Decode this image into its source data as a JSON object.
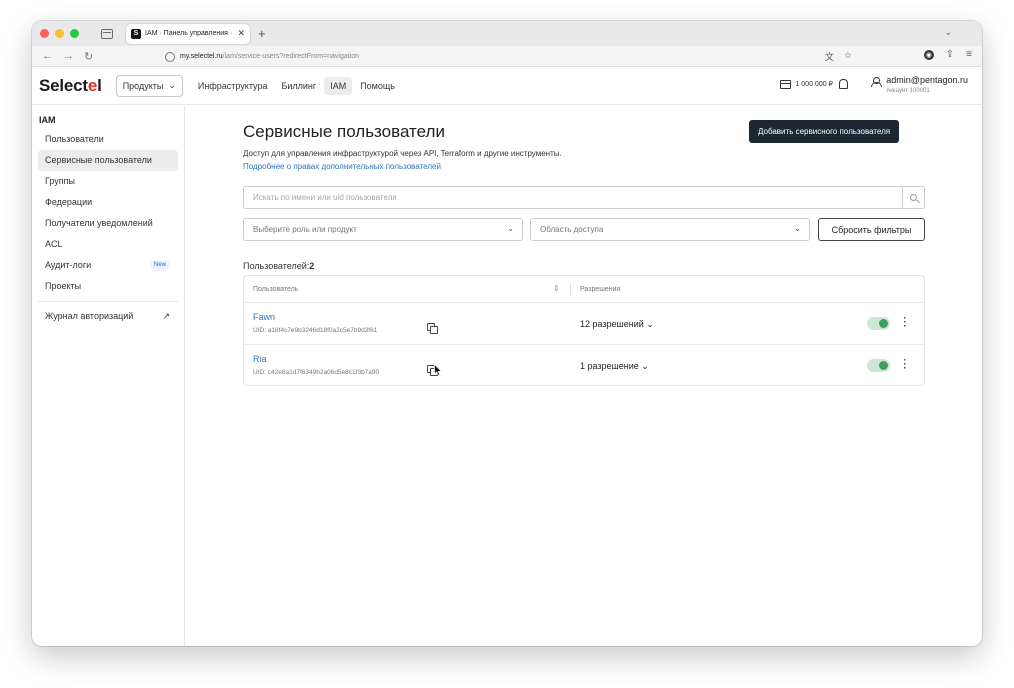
{
  "browser": {
    "tab_title": "IAM · Панель управления · Sele",
    "tab_favicon": "S",
    "url_host": "my.selectel.ru",
    "url_path": "/iam/service-users?redirectFrom=navigation"
  },
  "header": {
    "logo_main": "Select",
    "logo_accent": "e",
    "logo_end": "l",
    "products_label": "Продукты",
    "nav": [
      "Инфраструктура",
      "Биллинг",
      "IAM",
      "Помощь"
    ],
    "balance": "1 000 000 ₽",
    "account_email": "admin@pentagon.ru",
    "account_id": "Аккаунт 100001"
  },
  "sidebar": {
    "title": "IAM",
    "items": [
      {
        "label": "Пользователи"
      },
      {
        "label": "Сервисные пользователи"
      },
      {
        "label": "Группы"
      },
      {
        "label": "Федерации"
      },
      {
        "label": "Получатели уведомлений"
      },
      {
        "label": "ACL"
      },
      {
        "label": "Аудит-логи",
        "badge": "New"
      },
      {
        "label": "Проекты"
      }
    ],
    "journal_label": "Журнал авторизаций"
  },
  "main": {
    "title": "Сервисные пользователи",
    "add_button": "Добавить сервисного пользователя",
    "description": "Доступ для управления инфраструктурой через API, Terraform и другие инструменты.",
    "more_link": "Подробнее о правах дополнительных пользователей",
    "search_placeholder": "Искать по имени или uid пользователя",
    "role_select": "Выберите роль или продукт",
    "scope_select": "Область доступа",
    "reset_button": "Сбросить фильтры",
    "count_label": "Пользователей:",
    "count_value": "2",
    "table": {
      "col_user": "Пользователь",
      "col_permissions": "Разрешения",
      "rows": [
        {
          "name": "Fawn",
          "uid": "UID: a18f4c7e9b3246d18f0a2c5e7b9d3f61",
          "permissions": "12 разрешений",
          "enabled": true
        },
        {
          "name": "Ria",
          "uid": "UID: c42e8a1d7f6349b2a06d5e8c1f3b7a90",
          "permissions": "1 разрешение",
          "enabled": true
        }
      ]
    }
  },
  "colors": {
    "logo_accent": "#e3301e",
    "primary_button": "#1d2731",
    "link": "#2d74c8",
    "toggle_on": "#3f9e5d"
  }
}
